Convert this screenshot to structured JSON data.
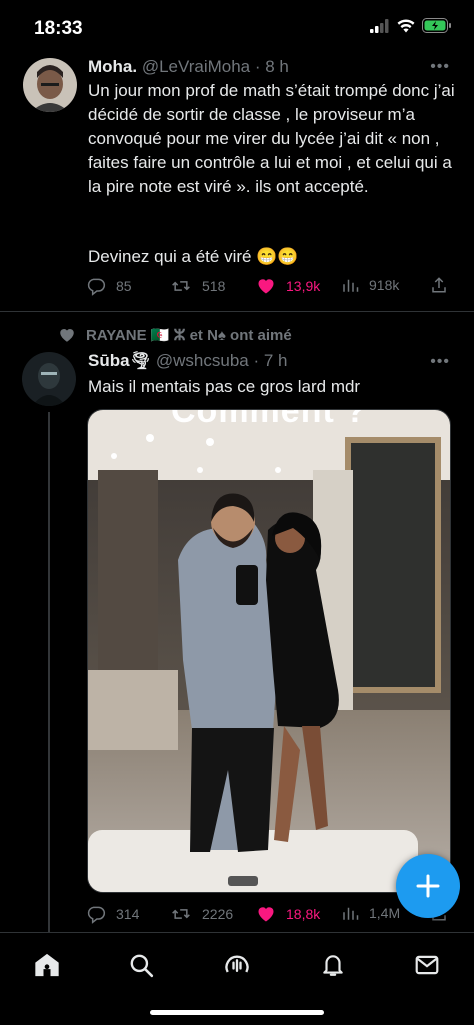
{
  "status_bar": {
    "time": "18:33"
  },
  "tweets": [
    {
      "name": "Moha.",
      "handle": "@LeVraiMoha",
      "time": "· 8 h",
      "text": "Un jour mon prof de math s’était trompé donc j’ai décidé de sortir de classe , le proviseur m’a convoqué pour me virer du lycée j’ai dit « non , faites faire un contrôle a lui et moi , et celui qui a la pire note est viré ». ils ont accepté.",
      "text2": "Devinez qui a été viré 😁😁",
      "replies": "85",
      "retweets": "518",
      "likes": "13,9k",
      "views": "918k"
    },
    {
      "social_context": "RAYANE 🇩🇿 ⵣ et N♠ ont aimé",
      "name": "Sūba🌪",
      "handle": "@wshcsuba",
      "time": "· 7 h",
      "text": "Mais il mentais pas ce gros lard mdr",
      "media_caption": "Comment ?",
      "replies": "314",
      "retweets": "2226",
      "likes": "18,8k",
      "views": "1,4M"
    }
  ],
  "nav": [
    "home-icon",
    "search-icon",
    "spaces-icon",
    "bell-icon",
    "mail-icon"
  ],
  "colors": {
    "like": "#f91880",
    "accent": "#1d9bf0",
    "muted": "#71767b"
  }
}
